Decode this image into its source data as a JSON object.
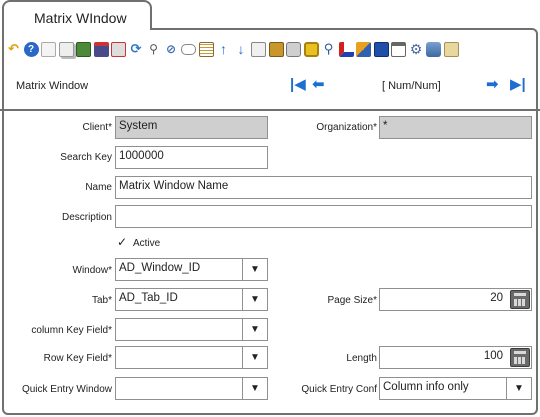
{
  "tab_title": "Matrix WIndow",
  "toolbar": [
    "undo-icon",
    "help-icon",
    "new-icon",
    "copy-icon",
    "delete-icon",
    "save-icon",
    "print-preview-icon",
    "refresh-icon",
    "find-icon",
    "attachment-icon",
    "chat-icon",
    "grid-toggle-icon",
    "previous-record-icon",
    "next-record-icon",
    "report-icon",
    "archive-icon",
    "print-icon",
    "lock-icon",
    "zoom-across-icon",
    "workflow-icon",
    "product-info-icon",
    "book-icon",
    "window-icon",
    "settings-icon",
    "export-icon",
    "exit-icon"
  ],
  "nav": {
    "window_name": "Matrix Window",
    "record": "[ Num/Num]"
  },
  "fields": {
    "client": {
      "label": "Client",
      "value": "System"
    },
    "organization": {
      "label": "Organization",
      "value": "*"
    },
    "search_key": {
      "label": "Search Key",
      "value": "1000000"
    },
    "name": {
      "label": "Name",
      "value": "Matrix Window Name"
    },
    "description": {
      "label": "Description",
      "value": ""
    },
    "active": {
      "label": "Active",
      "checked": true
    },
    "window": {
      "label": "Window",
      "value": "AD_Window_ID"
    },
    "tab": {
      "label": "Tab",
      "value": "AD_Tab_ID"
    },
    "page_size": {
      "label": "Page Size",
      "value": "20"
    },
    "column_key_field": {
      "label": "column Key Field",
      "value": ""
    },
    "row_key_field": {
      "label": "Row Key Field",
      "value": ""
    },
    "length": {
      "label": "Length",
      "value": "100"
    },
    "quick_entry_window": {
      "label": "Quick Entry Window",
      "value": ""
    },
    "quick_entry_conf": {
      "label": "Quick Entry Conf",
      "value": "Column info only"
    }
  },
  "required_mark": "*"
}
